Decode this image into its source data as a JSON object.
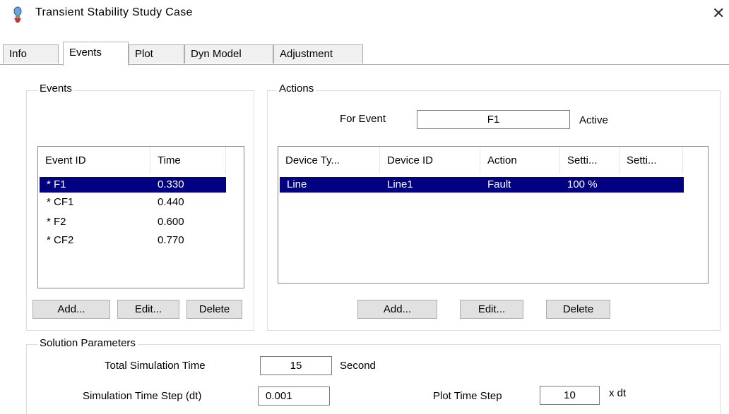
{
  "window": {
    "title": "Transient Stability Study Case",
    "close_glyph": "✕"
  },
  "tabs": [
    {
      "label": "Info"
    },
    {
      "label": "Events"
    },
    {
      "label": "Plot"
    },
    {
      "label": "Dyn Model"
    },
    {
      "label": "Adjustment"
    }
  ],
  "active_tab": "Events",
  "events": {
    "group_title": "Events",
    "columns": [
      "Event ID",
      "Time"
    ],
    "rows": [
      {
        "id": "* F1",
        "time": "0.330",
        "selected": true
      },
      {
        "id": "* CF1",
        "time": "0.440"
      },
      {
        "id": "* F2",
        "time": "0.600"
      },
      {
        "id": "* CF2",
        "time": "0.770"
      }
    ],
    "buttons": {
      "add": "Add...",
      "edit": "Edit...",
      "delete": "Delete"
    }
  },
  "actions": {
    "group_title": "Actions",
    "for_event_label": "For Event",
    "for_event_value": "F1",
    "status": "Active",
    "columns": [
      "Device Ty...",
      "Device ID",
      "Action",
      "Setti...",
      "Setti..."
    ],
    "rows": [
      {
        "device_type": "Line",
        "device_id": "Line1",
        "action": "Fault",
        "setting1": "100 %",
        "setting2": "",
        "selected": true
      }
    ],
    "buttons": {
      "add": "Add...",
      "edit": "Edit...",
      "delete": "Delete"
    }
  },
  "solution": {
    "group_title": "Solution Parameters",
    "total_time_label": "Total Simulation Time",
    "total_time_value": "15",
    "total_time_unit": "Second",
    "time_step_label": "Simulation Time Step (dt)",
    "time_step_value": "0.001",
    "plot_step_label": "Plot Time Step",
    "plot_step_value": "10",
    "plot_step_unit": "x  dt"
  },
  "colors": {
    "selection": "#000080",
    "button": "#e1e1e1"
  },
  "icons": {
    "app": "bulb-icon",
    "close": "close-icon"
  }
}
